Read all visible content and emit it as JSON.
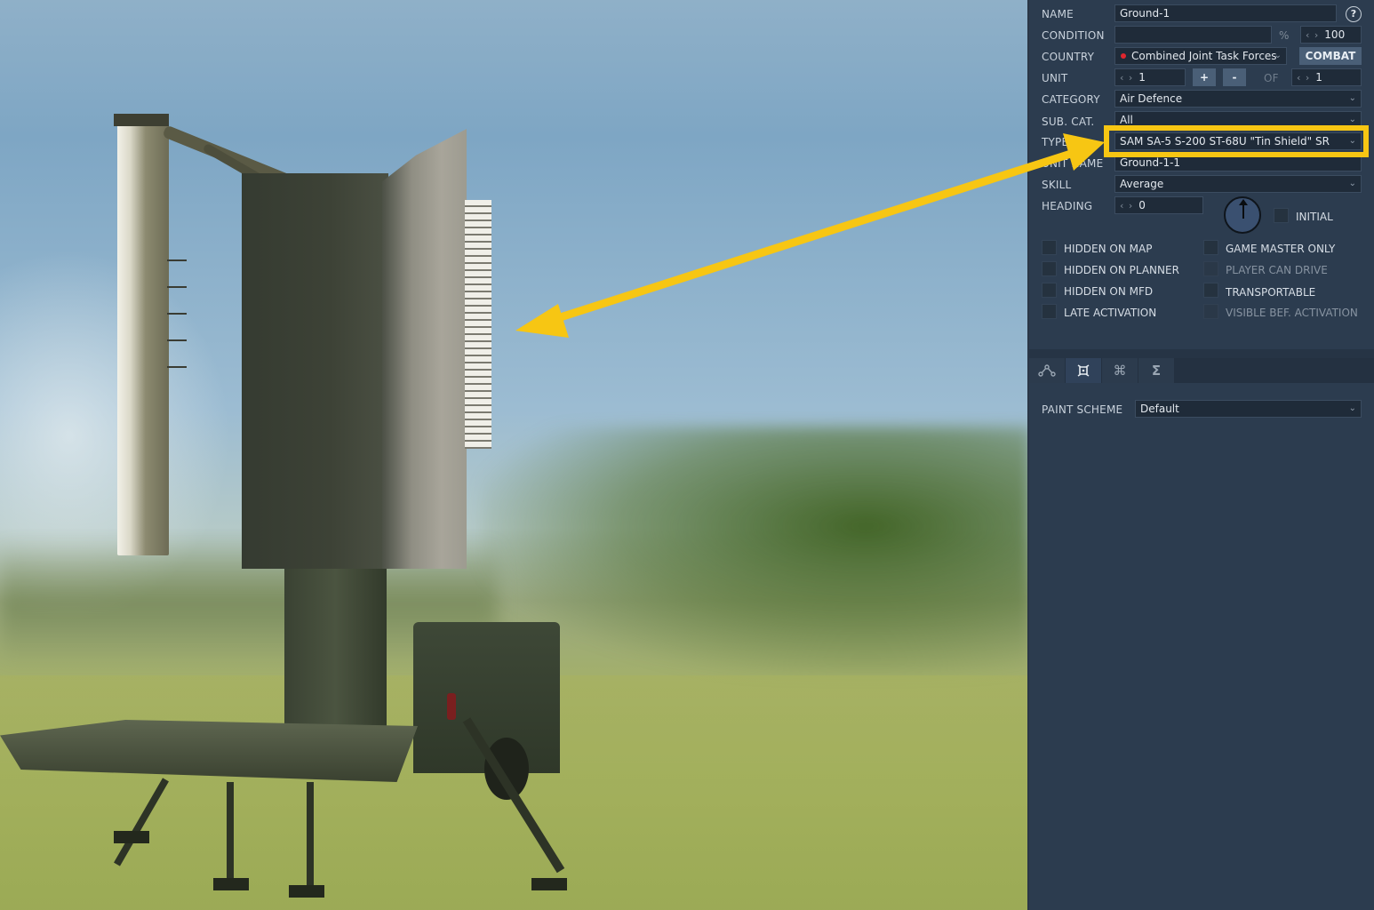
{
  "scene": {
    "description": "3D preview of SAM SA-5 S-200 ST-68U Tin Shield search radar on trailer",
    "annotation_color": "#f7c613"
  },
  "panel": {
    "help_label": "?",
    "name": {
      "label": "NAME",
      "value": "Ground-1"
    },
    "condition": {
      "label": "CONDITION",
      "value": "",
      "percent_symbol": "%",
      "percent_value": "100"
    },
    "country": {
      "label": "COUNTRY",
      "value": "Combined Joint Task Forces",
      "dot_color": "#e0262e",
      "combat_label": "COMBAT"
    },
    "unit": {
      "label": "UNIT",
      "value": "1",
      "plus_label": "+",
      "minus_label": "-",
      "of_label": "OF",
      "of_value": "1"
    },
    "category": {
      "label": "CATEGORY",
      "value": "Air Defence"
    },
    "subcat": {
      "label": "SUB. CAT.",
      "value": "All"
    },
    "type": {
      "label": "TYPE",
      "value": "SAM SA-5 S-200 ST-68U \"Tin Shield\" SR"
    },
    "unit_name": {
      "label": "UNIT NAME",
      "value": "Ground-1-1"
    },
    "skill": {
      "label": "SKILL",
      "value": "Average"
    },
    "heading": {
      "label": "HEADING",
      "value": "0",
      "initial_label": "INITIAL"
    },
    "spin_glyph": "‹ ›",
    "chevron_glyph": "⌄",
    "checkboxes_left": [
      {
        "label": "HIDDEN ON MAP",
        "checked": false,
        "enabled": true
      },
      {
        "label": "HIDDEN ON PLANNER",
        "checked": false,
        "enabled": true
      },
      {
        "label": "HIDDEN ON MFD",
        "checked": false,
        "enabled": true
      },
      {
        "label": "LATE ACTIVATION",
        "checked": false,
        "enabled": true
      }
    ],
    "checkboxes_right": [
      {
        "label": "GAME MASTER ONLY",
        "checked": false,
        "enabled": true
      },
      {
        "label": "PLAYER CAN DRIVE",
        "checked": false,
        "enabled": false
      },
      {
        "label": "TRANSPORTABLE",
        "checked": false,
        "enabled": true
      },
      {
        "label": "VISIBLE BEF. ACTIVATION",
        "checked": false,
        "enabled": false
      }
    ],
    "tabs": [
      {
        "name": "route",
        "glyph": "⌒",
        "active": false
      },
      {
        "name": "unit-properties",
        "glyph": "⌑",
        "active": true
      },
      {
        "name": "triggered-actions",
        "glyph": "⌘",
        "active": false
      },
      {
        "name": "summary",
        "glyph": "Σ",
        "active": false
      }
    ],
    "paint_scheme": {
      "label": "PAINT SCHEME",
      "value": "Default"
    }
  }
}
